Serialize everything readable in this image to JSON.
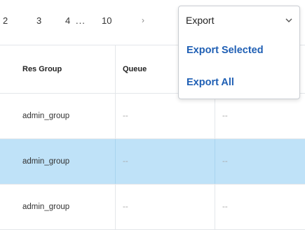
{
  "pagination": {
    "partial_prev": "2",
    "page_3": "3",
    "page_4": "4",
    "ellipsis": "...",
    "page_10": "10",
    "next": "›"
  },
  "export": {
    "label": "Export",
    "options": [
      "Export Selected",
      "Export All"
    ]
  },
  "table": {
    "columns": [
      "Res Group",
      "Queue",
      ""
    ],
    "rows": [
      {
        "res_group": "admin_group",
        "queue": "--",
        "col3": "--",
        "selected": false
      },
      {
        "res_group": "admin_group",
        "queue": "--",
        "col3": "--",
        "selected": true
      },
      {
        "res_group": "admin_group",
        "queue": "--",
        "col3": "--",
        "selected": false
      }
    ]
  },
  "colors": {
    "selected_row": "#bfe2f8",
    "link_blue": "#1f5fb4",
    "border": "#e3e6ea"
  }
}
